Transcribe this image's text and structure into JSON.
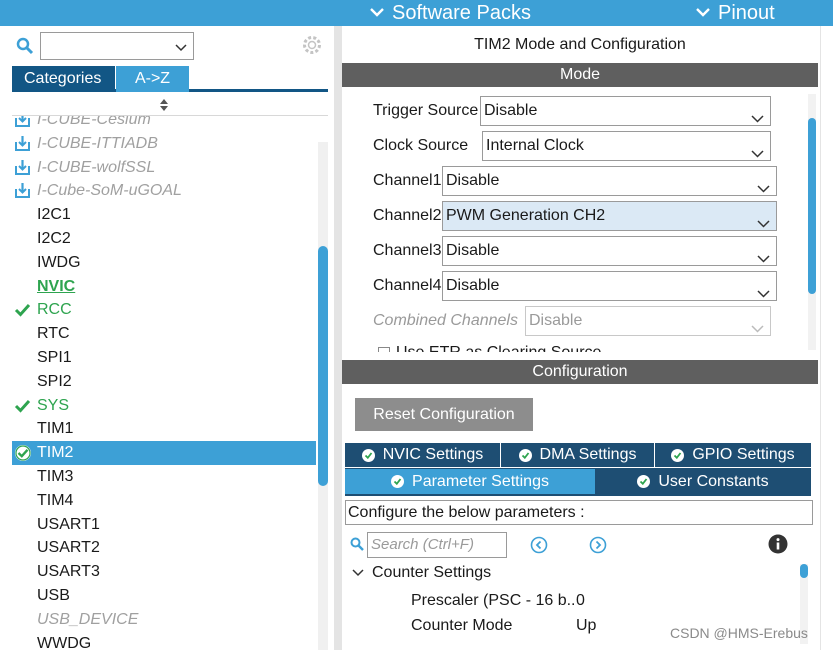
{
  "header": {
    "software_packs": "Software Packs",
    "pinout": "Pinout"
  },
  "left": {
    "search_value": "",
    "tabs": [
      "Categories",
      "A->Z"
    ],
    "items": [
      {
        "label": "I-CUBE-Cesium",
        "style": "grey",
        "icon": "download-icon"
      },
      {
        "label": "I-CUBE-ITTIADB",
        "style": "grey",
        "icon": "download-icon"
      },
      {
        "label": "I-CUBE-wolfSSL",
        "style": "grey",
        "icon": "download-icon"
      },
      {
        "label": "I-Cube-SoM-uGOAL",
        "style": "grey",
        "icon": "download-icon"
      },
      {
        "label": "I2C1",
        "style": "normal",
        "icon": ""
      },
      {
        "label": "I2C2",
        "style": "normal",
        "icon": ""
      },
      {
        "label": "IWDG",
        "style": "normal",
        "icon": ""
      },
      {
        "label": "NVIC",
        "style": "nvic",
        "icon": ""
      },
      {
        "label": "RCC",
        "style": "green",
        "icon": "check-icon"
      },
      {
        "label": "RTC",
        "style": "normal",
        "icon": ""
      },
      {
        "label": "SPI1",
        "style": "normal",
        "icon": ""
      },
      {
        "label": "SPI2",
        "style": "normal",
        "icon": ""
      },
      {
        "label": "SYS",
        "style": "green",
        "icon": "check-icon"
      },
      {
        "label": "TIM1",
        "style": "normal",
        "icon": ""
      },
      {
        "label": "TIM2",
        "style": "sel",
        "icon": "check-circle-icon"
      },
      {
        "label": "TIM3",
        "style": "normal",
        "icon": ""
      },
      {
        "label": "TIM4",
        "style": "normal",
        "icon": ""
      },
      {
        "label": "USART1",
        "style": "normal",
        "icon": ""
      },
      {
        "label": "USART2",
        "style": "normal",
        "icon": ""
      },
      {
        "label": "USART3",
        "style": "normal",
        "icon": ""
      },
      {
        "label": "USB",
        "style": "normal",
        "icon": ""
      },
      {
        "label": "USB_DEVICE",
        "style": "grey",
        "icon": ""
      },
      {
        "label": "WWDG",
        "style": "normal",
        "icon": ""
      }
    ]
  },
  "right": {
    "title": "TIM2 Mode and Configuration",
    "mode_header": "Mode",
    "fields": {
      "trigger": {
        "label": "Trigger Source",
        "value": "Disable"
      },
      "clock": {
        "label": "Clock Source",
        "value": "Internal Clock"
      },
      "ch1": {
        "label": "Channel1",
        "value": "Disable"
      },
      "ch2": {
        "label": "Channel2",
        "value": "PWM Generation CH2"
      },
      "ch3": {
        "label": "Channel3",
        "value": "Disable"
      },
      "ch4": {
        "label": "Channel4",
        "value": "Disable"
      },
      "combined": {
        "label": "Combined Channels",
        "value": "Disable"
      }
    },
    "cut_row": "Use ETR as Clearing Source",
    "config_header": "Configuration",
    "reset_button": "Reset Configuration",
    "tabs_row1": [
      "NVIC Settings",
      "DMA Settings",
      "GPIO Settings"
    ],
    "tabs_row2": [
      "Parameter Settings",
      "User Constants"
    ],
    "describe": "Configure the below parameters :",
    "search_placeholder": "Search (Ctrl+F)",
    "counter_settings": "Counter Settings",
    "params": [
      {
        "name": "Prescaler (PSC - 16 b..",
        "value": "0"
      },
      {
        "name": "Counter Mode",
        "value": "Up"
      }
    ]
  },
  "watermark": "CSDN @HMS-Erebus",
  "colors": {
    "accent": "#3da0d6",
    "dark_tab": "#1e4e73",
    "header_grey": "#5f5f5f",
    "ok_green": "#2ea44f"
  }
}
